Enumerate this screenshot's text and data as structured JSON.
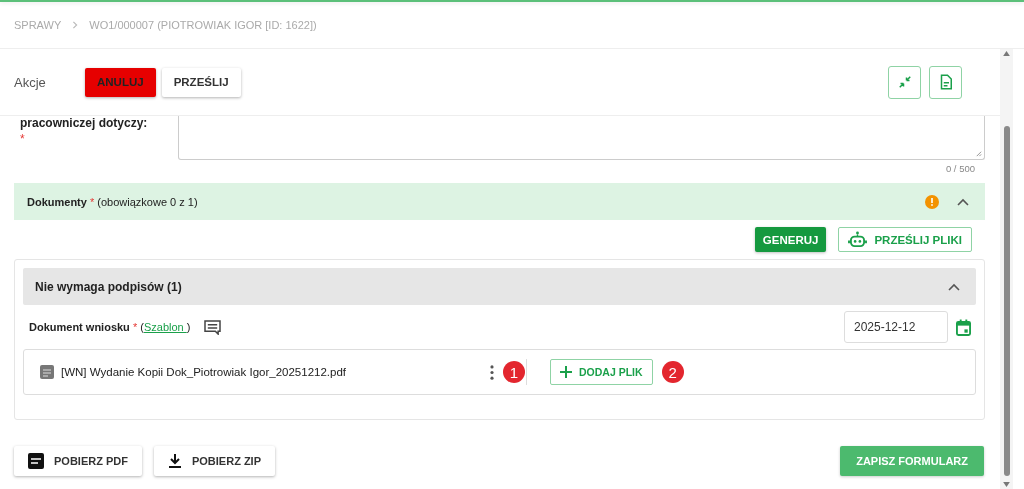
{
  "breadcrumb": [
    "SPRAWY",
    "WO1/000007 (PIOTROWIAK IGOR [ID: 1622])"
  ],
  "actions": {
    "label": "Akcje",
    "buttons": [
      {
        "label": "ANULUJ",
        "kind": "danger"
      },
      {
        "label": "PRZEŚLIJ",
        "kind": "plain"
      }
    ]
  },
  "question": {
    "label": "pracowniczej dotyczy:",
    "required_mark": "*",
    "counter": "0 / 500"
  },
  "documents": {
    "title": "Dokumenty",
    "required_mark": "*",
    "note": "(obowiązkowe 0 z 1)",
    "warning": true,
    "expanded": true,
    "buttons": [
      {
        "label": "GENERUJ",
        "kind": "primary"
      },
      {
        "label": "PRZEŚLIJ PLIKI",
        "kind": "outline"
      }
    ],
    "group": {
      "title": "Nie wymaga podpisów (1)",
      "expanded": true,
      "document": {
        "label": "Dokument wniosku",
        "required_mark": "*",
        "paren_open": "(",
        "link": "Szablon ",
        "paren_close": ")",
        "date": "2025-12-12",
        "file": "[WN] Wydanie Kopii Dok_Piotrowiak Igor_20251212.pdf",
        "marker_1": "1",
        "add_button": "DODAJ PLIK",
        "marker_2": "2"
      }
    }
  },
  "footer": {
    "buttons": [
      {
        "label": "POBIERZ PDF",
        "kind": "pdf"
      },
      {
        "label": "POBIERZ ZIP",
        "kind": "zip"
      }
    ],
    "save": "ZAPISZ FORMULARZ"
  }
}
